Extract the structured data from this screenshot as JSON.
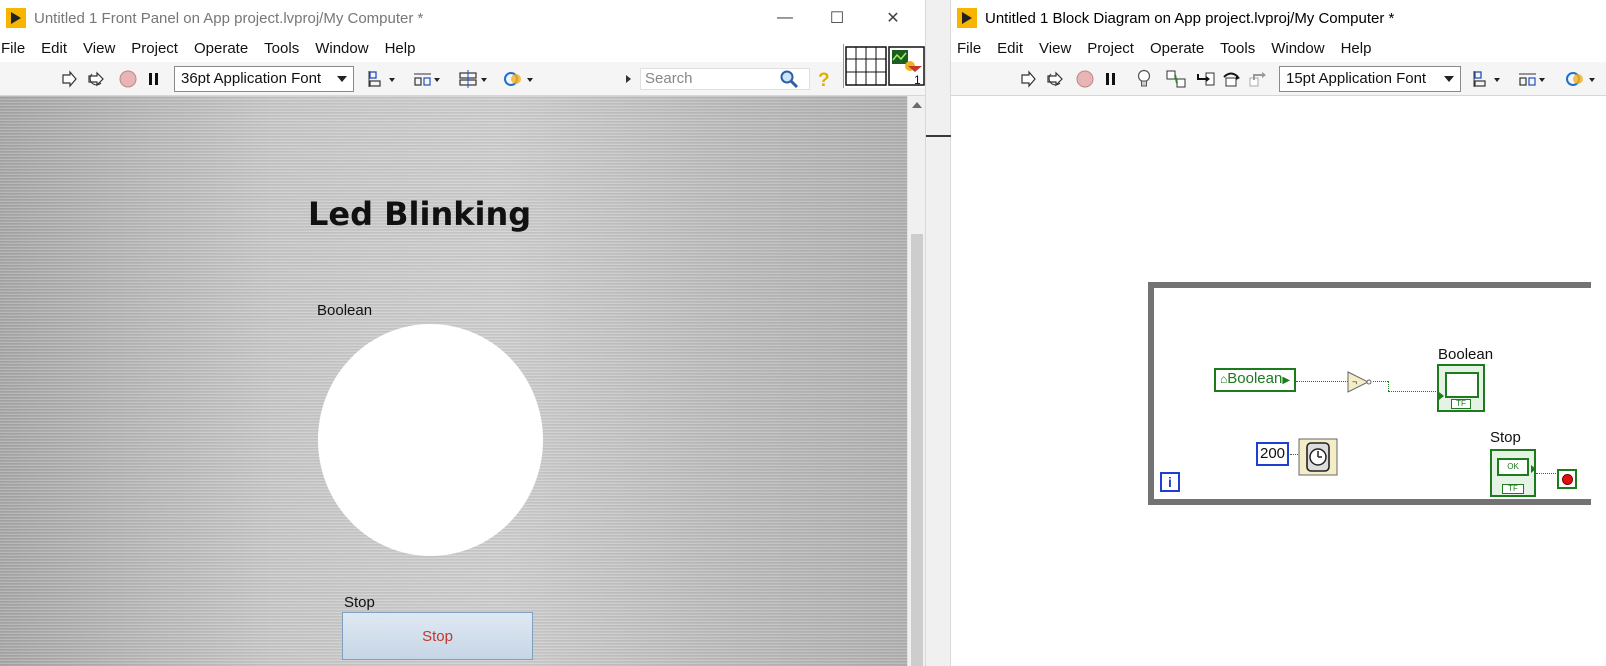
{
  "front_panel": {
    "title": "Untitled 1 Front Panel on App project.lvproj/My Computer *",
    "menu": [
      "File",
      "Edit",
      "View",
      "Project",
      "Operate",
      "Tools",
      "Window",
      "Help"
    ],
    "font_selector": "36pt Application Font",
    "search_placeholder": "Search",
    "connector_pane_number": "1",
    "heading": "Led Blinking",
    "boolean_label": "Boolean",
    "stop_label": "Stop",
    "stop_button_text": "Stop"
  },
  "block_diagram": {
    "title": "Untitled 1 Block Diagram on App project.lvproj/My Computer *",
    "menu": [
      "File",
      "Edit",
      "View",
      "Project",
      "Operate",
      "Tools",
      "Window",
      "Help"
    ],
    "font_selector": "15pt Application Font",
    "boolean_local_variable": "Boolean",
    "boolean_indicator_label": "Boolean",
    "wait_constant": "200",
    "stop_label": "Stop",
    "loop_iteration_label": "i",
    "tf_label": "TF",
    "ok_label": "OK"
  },
  "colors": {
    "labview_green": "#1d7a1d",
    "constant_blue": "#1f3fcf",
    "stop_red": "#c0392b",
    "loop_gray": "#737373",
    "app_icon_yellow": "#f7b500"
  },
  "icons": [
    "labview-app-icon",
    "run-arrow-icon",
    "run-continuous-icon",
    "abort-icon",
    "pause-icon",
    "align-icon",
    "distribute-icon",
    "resize-icon",
    "reorder-icon",
    "search-icon",
    "help-icon",
    "highlight-execution-icon",
    "retain-wire-values-icon",
    "step-into-icon",
    "step-over-icon",
    "step-out-icon",
    "not-function-icon",
    "wait-ms-icon",
    "stop-terminal-icon"
  ]
}
